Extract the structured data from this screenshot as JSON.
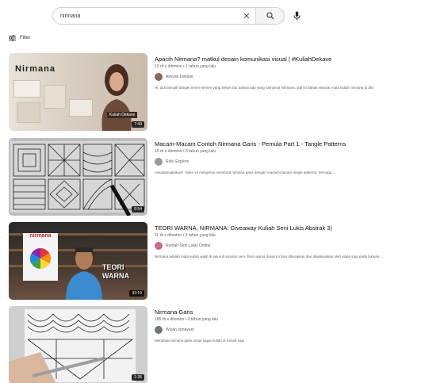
{
  "search": {
    "query": "nirmana",
    "clear_glyph": "✕"
  },
  "filter": {
    "label": "Filter"
  },
  "results": [
    {
      "title": "Apaсih Nirmana? matkul desain komunikasi visual | #KuliahDekave",
      "meta": "13 rb x ditonton • 1 tahun yang lalu",
      "channel": "Ainiyah Dekave",
      "description": "Hi, jadi banyak banget temen-temen yang belum tau bahwa ada yang namanya Nirmana, jadi ini bahas seputar mata kuliah nirmana di dkv",
      "duration": "7:49",
      "thumb_text": "Nirmana",
      "thumb_badge": "Kuliah Dekave"
    },
    {
      "title": "Macam-Macam Contoh Nirmana Garis - Pemula Part 1 - Tangle Patterns",
      "meta": "15 rb x ditonton • 3 tahun yang lalu",
      "channel": "Rizki Explore",
      "description": "Assalamualaikum! Video ini mengenai membuat nirmana garis dengan macam-macam tangle patterns. Semoga...",
      "duration": "8:54"
    },
    {
      "title": "TEORI WARNA, NIRMANA: Giveaway Kuliah Seni Lukis Abstrak 3)",
      "meta": "11 rb x ditonton • 2 tahun yang lalu",
      "channel": "Rumah Seni Lukis Online",
      "description": "Nirmana adalah mata kuliah wajib di seluruh jurusan seni. Teori warna dasar ini bisa diterapkan dan diaplikasikan oleh siapa saja pada lukisan...",
      "duration": "33:19",
      "thumb_text": "nirmana",
      "thumb_badge": "TEORI WARNA"
    },
    {
      "title": "Nirmana Garis",
      "meta": "185 rb x ditonton • 3 tahun yang lalu",
      "channel": "Wulan Ismayani",
      "description": "Membuat nirmana garis untuk tugas kuliah di rumah saja",
      "duration": "1:36"
    }
  ],
  "colors": {
    "accent": "#0f0f0f",
    "secondary_text": "#606060",
    "border": "#d0d0d0"
  }
}
